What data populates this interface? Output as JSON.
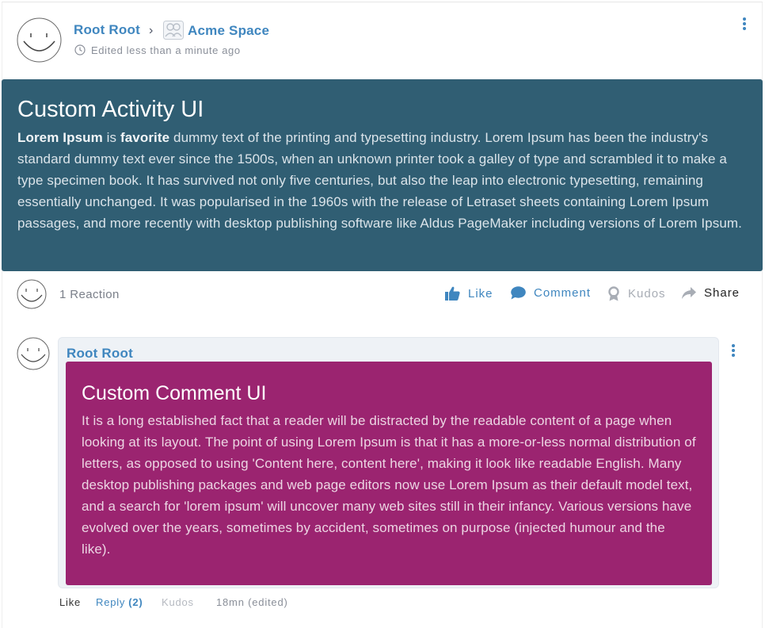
{
  "activity": {
    "author": "Root Root",
    "breadcrumb_separator": "›",
    "space_name": "Acme Space",
    "edited_text": "Edited less than a minute ago",
    "title": "Custom Activity UI",
    "body_strong_1": "Lorem Ipsum",
    "body_mid_1": " is ",
    "body_strong_2": "favorite",
    "body_rest": " dummy text of the printing and typesetting industry. Lorem Ipsum has been the industry's standard dummy text ever since the 1500s, when an unknown printer took a galley of type and scrambled it to make a type specimen book. It has survived not only five centuries, but also the leap into electronic typesetting, remaining essentially unchanged. It was popularised in the 1960s with the release of Letraset sheets containing Lorem Ipsum passages, and more recently with desktop publishing software like Aldus PageMaker including versions of Lorem Ipsum.",
    "box_color": "#305e73"
  },
  "reactions": {
    "count_label": "1 Reaction"
  },
  "actions": {
    "like": "Like",
    "comment": "Comment",
    "kudos": "Kudos",
    "share": "Share"
  },
  "comment": {
    "author": "Root Root",
    "title": "Custom Comment UI",
    "body": "It is a long established fact that a reader will be distracted by the readable content of a page when looking at its layout. The point of using Lorem Ipsum is that it has a more-or-less normal distribution of letters, as opposed to using 'Content here, content here', making it look like readable English. Many desktop publishing packages and web page editors now use Lorem Ipsum as their default model text, and a search for 'lorem ipsum' will uncover many web sites still in their infancy. Various versions have evolved over the years, sometimes by accident, sometimes on purpose (injected humour and the like).",
    "box_color": "#9b2470",
    "like": "Like",
    "reply": "Reply",
    "reply_count": "(2)",
    "kudos": "Kudos",
    "time": "18mn (edited)"
  },
  "icons": {
    "avatar": "smiley-avatar-icon",
    "space": "space-avatar-icon",
    "clock": "clock-icon",
    "more": "kebab-menu-icon",
    "like": "thumbs-up-icon",
    "comment": "comment-bubble-icon",
    "kudos": "kudos-medal-icon",
    "share": "share-arrow-icon"
  },
  "colors": {
    "link": "#3f86bf",
    "muted": "#8a8f99"
  }
}
